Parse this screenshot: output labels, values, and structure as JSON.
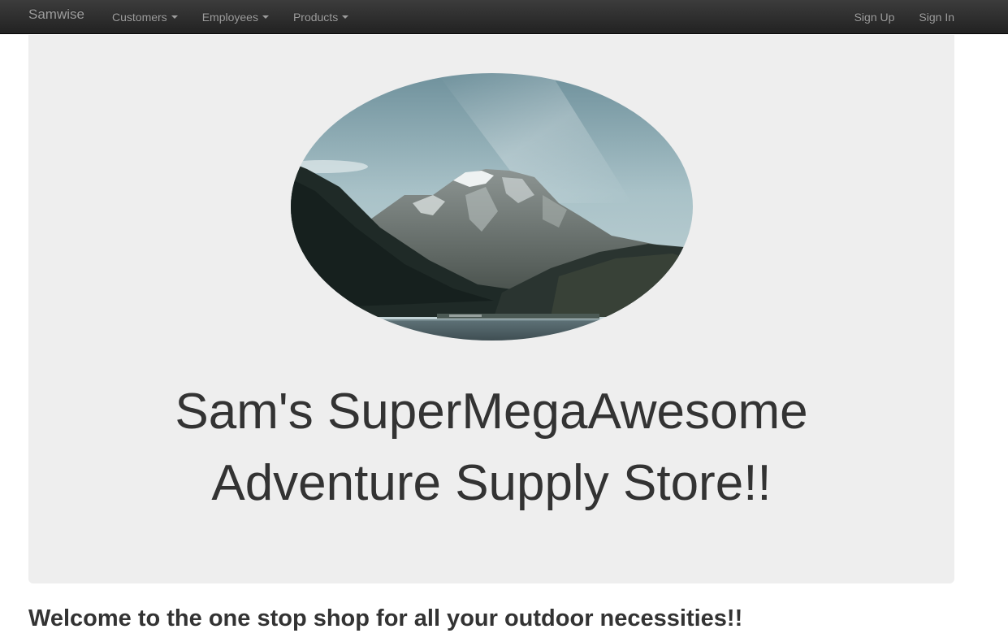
{
  "navbar": {
    "brand": "Samwise",
    "left_items": [
      {
        "label": "Customers"
      },
      {
        "label": "Employees"
      },
      {
        "label": "Products"
      }
    ],
    "right_items": [
      {
        "label": "Sign Up"
      },
      {
        "label": "Sign In"
      }
    ],
    "colors": {
      "background": "#222222",
      "text": "#9d9d9d"
    }
  },
  "jumbotron": {
    "image_alt": "mountain-lake-landscape",
    "title_line1": "Sam's SuperMegaAwesome",
    "title_line2": "Adventure Supply Store!!",
    "background": "#eeeeee"
  },
  "main": {
    "welcome": "Welcome to the one stop shop for all your outdoor necessities!!"
  }
}
